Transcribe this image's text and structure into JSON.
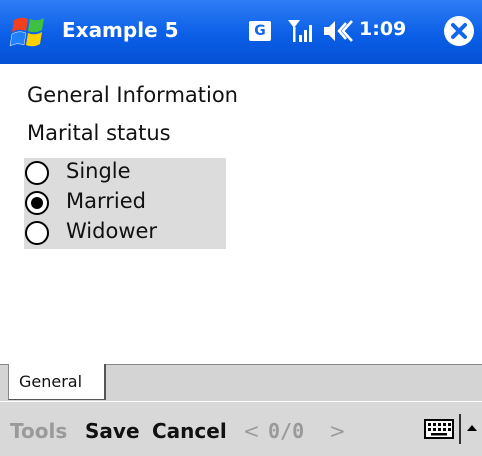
{
  "titlebar": {
    "app_title": "Example 5",
    "network_badge": "G",
    "clock": "1:09",
    "icons": [
      "windows-start-icon",
      "signal-icon",
      "volume-icon",
      "close-icon"
    ]
  },
  "content": {
    "section_title": "General Information",
    "field_label": "Marital status",
    "radio_options": [
      {
        "label": "Single",
        "selected": false
      },
      {
        "label": "Married",
        "selected": true
      },
      {
        "label": "Widower",
        "selected": false
      }
    ]
  },
  "tabs": [
    {
      "label": "General",
      "active": true
    }
  ],
  "command_bar": {
    "tools": "Tools",
    "save": "Save",
    "cancel": "Cancel",
    "prev": "<",
    "counter": "0/0",
    "next": ">",
    "icons": [
      "keyboard-icon",
      "caret-up-icon"
    ]
  },
  "colors": {
    "titlebar": "#1166ee",
    "radio_group_bg": "#dcdcdc",
    "command_bar_bg": "#d8d8d8",
    "disabled_text": "#9a9a9a"
  }
}
